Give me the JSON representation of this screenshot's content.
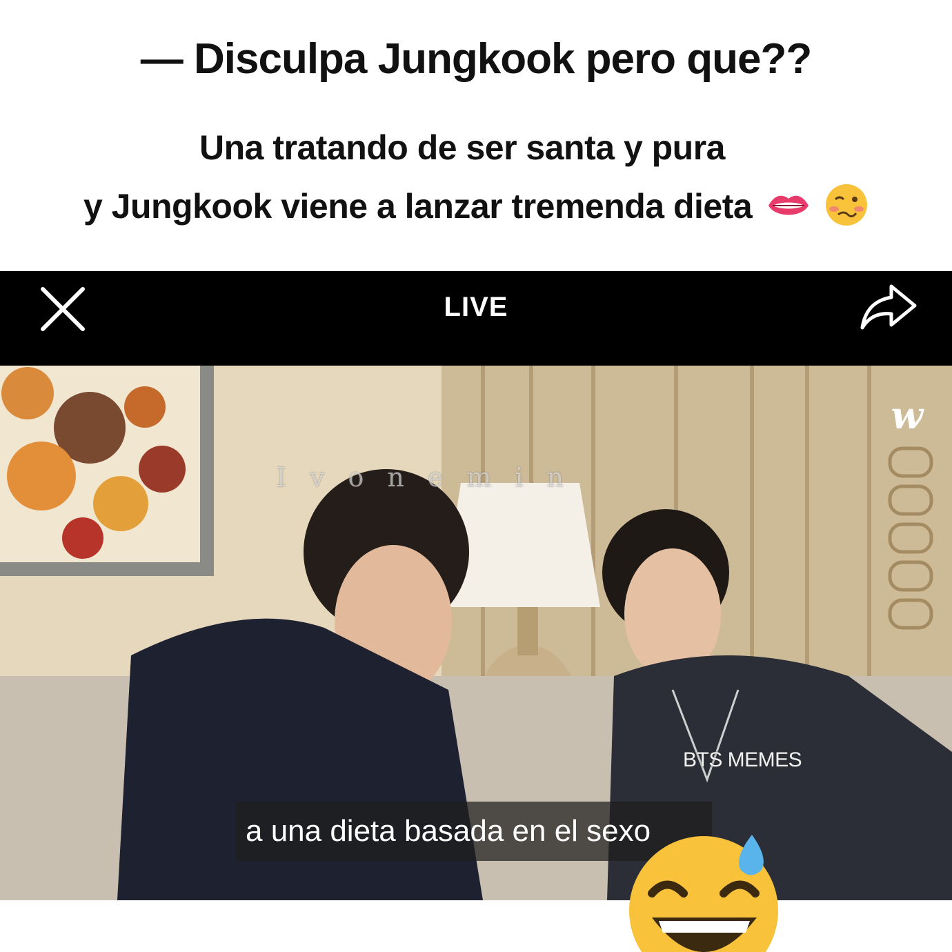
{
  "post": {
    "headline": "— Disculpa Jungkook pero que??",
    "caption_line1": "Una tratando de ser santa y pura",
    "caption_line2": "y Jungkook viene a lanzar tremenda dieta",
    "caption_emojis": [
      "lips-icon",
      "woozy-face-icon"
    ]
  },
  "live_bar": {
    "label": "LIVE",
    "close_icon": "close-icon",
    "share_icon": "share-icon"
  },
  "video": {
    "watermark_top": "Ivonemin",
    "weverse_logo": "w",
    "watermark_channel": "BTS MEMES",
    "subtitle": "a una dieta basada en el sexo"
  },
  "overlay_emoji": "grinning-sweat-face-icon"
}
